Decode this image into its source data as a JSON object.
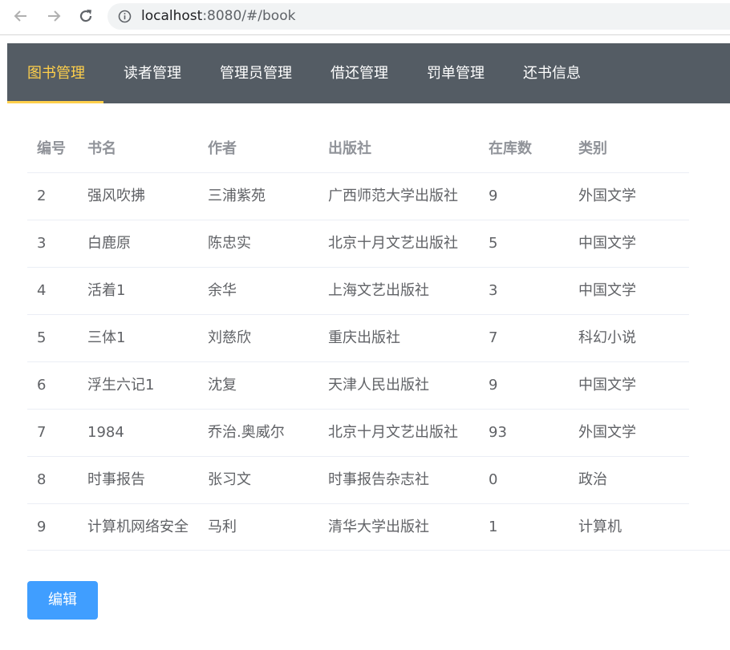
{
  "browser": {
    "url_host": "localhost",
    "url_rest": ":8080/#/book"
  },
  "nav": {
    "items": [
      "图书管理",
      "读者管理",
      "管理员管理",
      "借还管理",
      "罚单管理",
      "还书信息"
    ],
    "active_color": "#ffd04b",
    "background_color": "#545c64"
  },
  "table": {
    "headers": [
      "编号",
      "书名",
      "作者",
      "出版社",
      "在库数",
      "类别"
    ],
    "rows": [
      [
        "2",
        "强风吹拂",
        "三浦紫苑",
        "广西师范大学出版社",
        "9",
        "外国文学"
      ],
      [
        "3",
        "白鹿原",
        "陈忠实",
        "北京十月文艺出版社",
        "5",
        "中国文学"
      ],
      [
        "4",
        "活着1",
        "余华",
        "上海文艺出版社",
        "3",
        "中国文学"
      ],
      [
        "5",
        "三体1",
        "刘慈欣",
        "重庆出版社",
        "7",
        "科幻小说"
      ],
      [
        "6",
        "浮生六记1",
        "沈复",
        "天津人民出版社",
        "9",
        "中国文学"
      ],
      [
        "7",
        "1984",
        "乔治.奥威尔",
        "北京十月文艺出版社",
        "93",
        "外国文学"
      ],
      [
        "8",
        "时事报告",
        "张习文",
        "时事报告杂志社",
        "0",
        "政治"
      ],
      [
        "9",
        "计算机网络安全",
        "马利",
        "清华大学出版社",
        "1",
        "计算机"
      ]
    ]
  },
  "actions": {
    "edit_label": "编辑",
    "edit_color": "#409eff"
  }
}
